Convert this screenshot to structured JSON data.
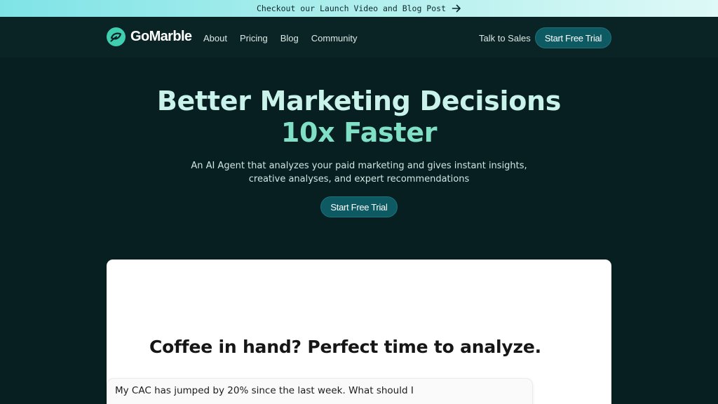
{
  "announcement": {
    "text": "Checkout our Launch Video and Blog Post",
    "icon": "arrow-right-icon"
  },
  "header": {
    "brand": "GoMarble",
    "nav": [
      {
        "label": "About"
      },
      {
        "label": "Pricing"
      },
      {
        "label": "Blog"
      },
      {
        "label": "Community"
      }
    ],
    "talk_to_sales": "Talk to Sales",
    "cta": "Start Free Trial"
  },
  "hero": {
    "title_line1": "Better Marketing Decisions",
    "title_line2": "10x Faster",
    "subtitle": "An AI Agent that analyzes your paid marketing and gives instant insights, creative analyses, and expert recommendations",
    "cta": "Start Free Trial"
  },
  "demo": {
    "heading": "Coffee in hand? Perfect time to analyze.",
    "prompt": "My CAC has jumped by 20% since the last week. What should I"
  },
  "colors": {
    "background": "#071f21",
    "accent": "#0e5a63",
    "brand_mark": "#3fcfb0",
    "title": "#c9f2ea",
    "title_highlight": "#7fe0c6"
  }
}
